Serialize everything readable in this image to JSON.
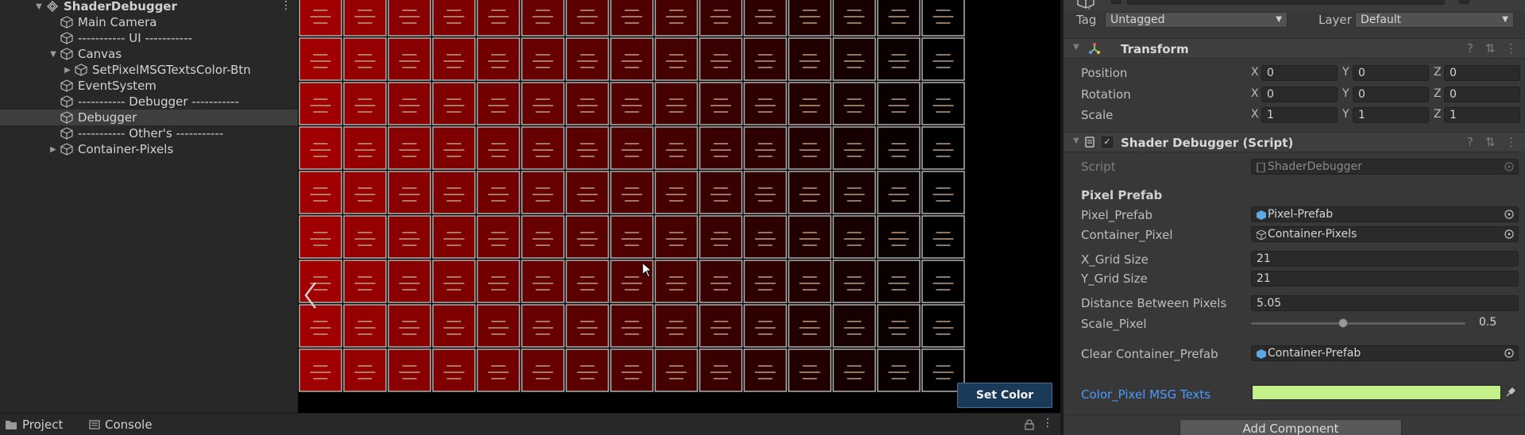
{
  "hierarchy": {
    "items": [
      {
        "label": "ShaderDebugger",
        "depth": 0,
        "expand": "down",
        "icon": "scene-icon",
        "bold": true
      },
      {
        "label": "Main Camera",
        "depth": 1,
        "expand": "none",
        "icon": "cube-icon"
      },
      {
        "label": "----------- UI -----------",
        "depth": 1,
        "expand": "none",
        "icon": "cube-icon"
      },
      {
        "label": "Canvas",
        "depth": 1,
        "expand": "down",
        "icon": "cube-icon"
      },
      {
        "label": "SetPixelMSGTextsColor-Btn",
        "depth": 2,
        "expand": "right",
        "icon": "cube-icon"
      },
      {
        "label": "EventSystem",
        "depth": 1,
        "expand": "none",
        "icon": "cube-icon"
      },
      {
        "label": "----------- Debugger -----------",
        "depth": 1,
        "expand": "none",
        "icon": "cube-icon"
      },
      {
        "label": "Debugger",
        "depth": 1,
        "expand": "none",
        "icon": "cube-icon",
        "selected": true
      },
      {
        "label": "----------- Other's -----------",
        "depth": 1,
        "expand": "none",
        "icon": "cube-icon"
      },
      {
        "label": "Container-Pixels",
        "depth": 1,
        "expand": "right",
        "icon": "cube-icon"
      }
    ]
  },
  "game_view": {
    "set_color_button": "Set Color",
    "pixel_grid": {
      "columns": 15,
      "rows": 9,
      "start_color": "#a00000",
      "end_color": "#000000"
    }
  },
  "bottom_tabs": {
    "project": "Project",
    "console": "Console"
  },
  "inspector": {
    "tag_label": "Tag",
    "tag_value": "Untagged",
    "layer_label": "Layer",
    "layer_value": "Default",
    "transform": {
      "title": "Transform",
      "rows": [
        {
          "label": "Position",
          "x": "0",
          "y": "0",
          "z": "0"
        },
        {
          "label": "Rotation",
          "x": "0",
          "y": "0",
          "z": "0"
        },
        {
          "label": "Scale",
          "x": "1",
          "y": "1",
          "z": "1"
        }
      ],
      "axis_x": "X",
      "axis_y": "Y",
      "axis_z": "Z"
    },
    "shader_debugger": {
      "title": "Shader Debugger (Script)",
      "script_label": "Script",
      "script_value": "ShaderDebugger",
      "pixel_prefab_header": "Pixel Prefab",
      "pixel_prefab_label": "Pixel_Prefab",
      "pixel_prefab_value": "Pixel-Prefab",
      "container_pixel_label": "Container_Pixel",
      "container_pixel_value": "Container-Pixels",
      "x_grid_label": "X_Grid Size",
      "x_grid_value": "21",
      "y_grid_label": "Y_Grid Size",
      "y_grid_value": "21",
      "distance_label": "Distance Between Pixels",
      "distance_value": "5.05",
      "scale_pixel_label": "Scale_Pixel",
      "scale_pixel_value": "0.5",
      "scale_pixel_fraction": 0.43,
      "clear_container_label": "Clear Container_Prefab",
      "clear_container_value": "Container-Prefab",
      "color_label": "Color_Pixel MSG Texts",
      "color_value": "#c4f08a"
    },
    "add_component": "Add Component"
  },
  "colors": {
    "accent_blue": "#4c9aff",
    "button_bg": "#1a3a5a",
    "selection": "#3e3e3e"
  }
}
